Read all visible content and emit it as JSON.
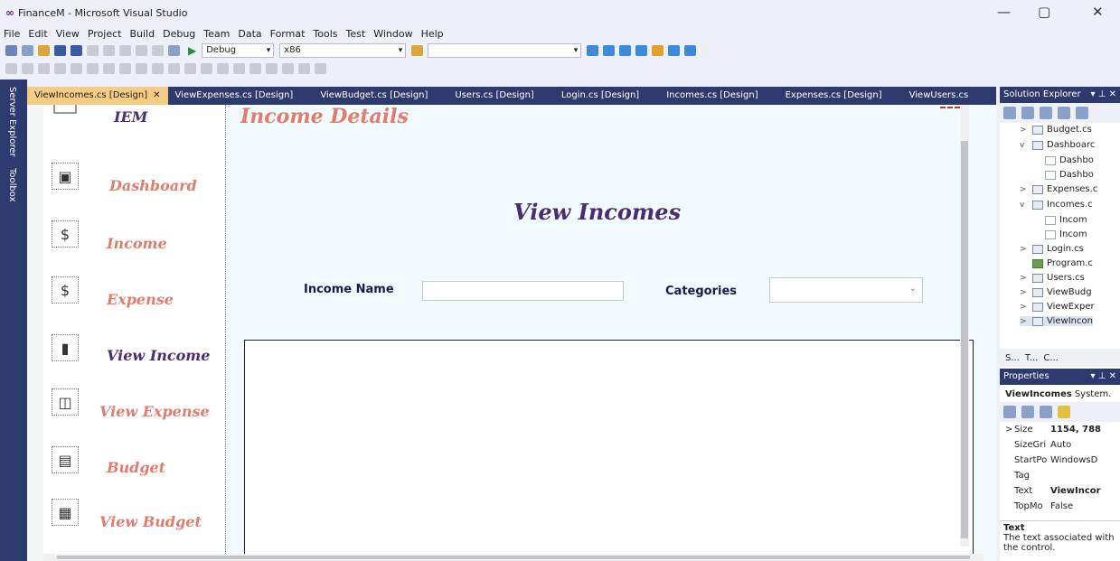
{
  "window": {
    "logo": "∞",
    "title": "FinanceM - Microsoft Visual Studio",
    "minimize": "—",
    "maximize": "▢",
    "close": "✕"
  },
  "menu": [
    "File",
    "Edit",
    "View",
    "Project",
    "Build",
    "Debug",
    "Team",
    "Data",
    "Format",
    "Tools",
    "Test",
    "Window",
    "Help"
  ],
  "toolbar": {
    "run_icon": "▶",
    "config": "Debug",
    "platform": "x86"
  },
  "side_tabs": {
    "server_explorer": "Server Explorer",
    "toolbox": "Toolbox"
  },
  "doc_tabs": [
    {
      "label": "ViewIncomes.cs [Design]",
      "close": "✕"
    },
    {
      "label": "ViewExpenses.cs [Design]"
    },
    {
      "label": "ViewBudget.cs [Design]"
    },
    {
      "label": "Users.cs [Design]"
    },
    {
      "label": "Login.cs [Design]"
    },
    {
      "label": "Incomes.cs [Design]"
    },
    {
      "label": "Expenses.cs [Design]"
    },
    {
      "label": "ViewUsers.cs"
    }
  ],
  "form": {
    "sidebar": {
      "brand": "IEM",
      "items": [
        {
          "label": "Dashboard",
          "icon": "dashboard-icon",
          "glyph": "▣"
        },
        {
          "label": "Income",
          "icon": "money-hand-icon",
          "glyph": "$"
        },
        {
          "label": "Expense",
          "icon": "dollar-refresh-icon",
          "glyph": "$"
        },
        {
          "label": "View Income",
          "icon": "bar-chart-person-icon",
          "glyph": "▮"
        },
        {
          "label": "View Expense",
          "icon": "wallet-icon",
          "glyph": "◫"
        },
        {
          "label": "Budget",
          "icon": "invoice-icon",
          "glyph": "▤"
        },
        {
          "label": "View Budget",
          "icon": "calculator-wallet-icon",
          "glyph": "▦"
        }
      ],
      "colors": {
        "accent": "#e07b6e",
        "active": "#4a2c75"
      }
    },
    "page_title": "Income Details",
    "heading": "View Incomes",
    "income_name_label": "Income Name",
    "income_name_value": "",
    "categories_label": "Categories",
    "categories_value": ""
  },
  "solution_explorer": {
    "title": "Solution Explorer",
    "items": [
      {
        "label": "Budget.cs",
        "arrow": ">"
      },
      {
        "label": "Dashboarc",
        "arrow": "v"
      },
      {
        "label": "Dashbo"
      },
      {
        "label": "Dashbo"
      },
      {
        "label": "Expenses.c",
        "arrow": ">"
      },
      {
        "label": "Incomes.c",
        "arrow": "v"
      },
      {
        "label": "Incom"
      },
      {
        "label": "Incom"
      },
      {
        "label": "Login.cs",
        "arrow": ">"
      },
      {
        "label": "Program.c"
      },
      {
        "label": "Users.cs",
        "arrow": ">"
      },
      {
        "label": "ViewBudg",
        "arrow": ">"
      },
      {
        "label": "ViewExper",
        "arrow": ">"
      },
      {
        "label": "ViewIncon",
        "arrow": ">"
      }
    ],
    "tabs": [
      "S...",
      "T...",
      "C..."
    ]
  },
  "properties": {
    "title": "Properties",
    "object_name": "ViewIncomes",
    "object_type": "System.",
    "rows": [
      {
        "name": "Size",
        "value": "1154, 788",
        "arrow": ">"
      },
      {
        "name": "SizeGri",
        "value": "Auto"
      },
      {
        "name": "StartPo",
        "value": "WindowsD"
      },
      {
        "name": "Tag",
        "value": ""
      },
      {
        "name": "Text",
        "value": "ViewIncor"
      },
      {
        "name": "TopMo",
        "value": "False"
      }
    ],
    "desc_title": "Text",
    "desc_text": "The text associated with the control."
  }
}
